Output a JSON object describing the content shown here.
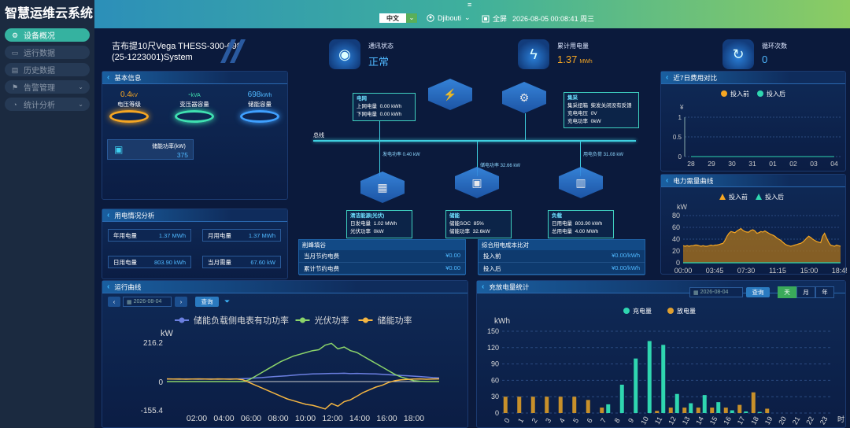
{
  "app": {
    "title": "智慧运维云系统"
  },
  "sidebar": {
    "items": [
      {
        "label": "设备概况",
        "icon": "gear-icon",
        "active": true
      },
      {
        "label": "运行数据",
        "icon": "monitor-icon"
      },
      {
        "label": "历史数据",
        "icon": "history-icon"
      },
      {
        "label": "告警管理",
        "icon": "bell-icon",
        "chevron": "⌄"
      },
      {
        "label": "统计分析",
        "icon": "stats-icon",
        "chevron": "⌄"
      }
    ]
  },
  "topbar": {
    "menu_glyph": "≡",
    "language": "中文",
    "language_chevron": "⌄",
    "user": "Djibouti",
    "user_chevron": "⌄",
    "fullscreen": "全屏",
    "datetime": "2026-08-05 00:08:41 周三"
  },
  "system": {
    "name_line1": "吉布提10尺Vega THESS-300-698",
    "name_line2": "(25-1223001)System"
  },
  "status": {
    "comm_label": "通讯状态",
    "comm_value": "正常",
    "energy_label": "累计用电量",
    "energy_value": "1.37",
    "energy_unit": "MWh",
    "cycles_label": "循环次数",
    "cycles_value": "0"
  },
  "basic": {
    "title": "基本信息",
    "voltage_value": "0.4",
    "voltage_unit": "kV",
    "voltage_label": "电压等级",
    "transformer_value": "-",
    "transformer_unit": "kVA",
    "transformer_label": "变压器容量",
    "storage_value": "698",
    "storage_unit": "kWh",
    "storage_label": "储能容量",
    "power_label": "储能功率(kW)",
    "power_value": "375"
  },
  "usage": {
    "title": "用电情况分析",
    "year_label": "年用电量",
    "year_value": "1.37 MWh",
    "month_label": "月用电量",
    "month_value": "1.37 MWh",
    "day_label": "日用电量",
    "day_value": "803.90 kWh",
    "demand_label": "当月需量",
    "demand_value": "67.60 kW"
  },
  "flow": {
    "bus_label": "总线",
    "grid": {
      "title": "电网",
      "r1_label": "上网电量",
      "r1_value": "0.00 kWh",
      "r2_label": "下网电量",
      "r2_value": "0.00 kWh"
    },
    "collector": {
      "title": "集采",
      "r1_label": "集采扭箱",
      "r1_value": "柴发关闭没有反馈",
      "r2_label": "充电电压",
      "r2_value": "0V",
      "r3_label": "充电功率",
      "r3_value": "0kW"
    },
    "pv_power": "发电功率 0.40 kW",
    "storage_power": "储电功率 32.66 kW",
    "load_power": "用电负荷 31.08 kW",
    "pv": {
      "title": "清洁能源(光伏)",
      "r1_label": "日发电量",
      "r1_value": "1.02 MWh",
      "r2_label": "光伏功率",
      "r2_value": "0kW"
    },
    "ess": {
      "title": "储能",
      "r1_label": "储能SOC",
      "r1_value": "85%",
      "r2_label": "储能功率",
      "r2_value": "32.6kW"
    },
    "load": {
      "title": "负载",
      "r1_label": "日用电量",
      "r1_value": "803.90 kWh",
      "r2_label": "总用电量",
      "r2_value": "4.00 MWh"
    }
  },
  "peak": {
    "title": "削峰填谷",
    "r1_label": "当月节约电费",
    "r1_value": "¥0.00",
    "r2_label": "累计节约电费",
    "r2_value": "¥0.00"
  },
  "cost": {
    "title": "综合用电成本比对",
    "r1_label": "投入前",
    "r1_value": "¥0.00/kWh",
    "r2_label": "投入后",
    "r2_value": "¥0.00/kWh"
  },
  "weekly": {
    "title": "近7日费用对比",
    "legend_before": "投入前",
    "legend_after": "投入后",
    "ylabel": "¥",
    "chart_data": {
      "type": "line",
      "categories": [
        "28",
        "29",
        "30",
        "31",
        "01",
        "02",
        "03",
        "04"
      ],
      "series": [
        {
          "name": "投入前",
          "values": [
            0,
            0,
            0,
            0,
            0,
            0,
            0,
            0
          ]
        },
        {
          "name": "投入后",
          "values": [
            0,
            0,
            0,
            0,
            0,
            0,
            0,
            0
          ]
        }
      ],
      "ylim": [
        0,
        1
      ],
      "yticks": [
        "1",
        "0.5",
        "0"
      ]
    }
  },
  "demand": {
    "title": "电力需量曲线",
    "legend_before": "投入前",
    "legend_after": "投入后",
    "ylabel": "kW",
    "chart_data": {
      "type": "area",
      "xticks": [
        "00:00",
        "03:45",
        "07:30",
        "11:15",
        "15:00",
        "18:45"
      ],
      "yticks": [
        "80",
        "60",
        "40",
        "20",
        "0"
      ],
      "ylim": [
        0,
        80
      ],
      "series": [
        {
          "name": "投入前",
          "values": [
            29,
            28,
            29,
            28,
            29,
            29,
            30,
            30,
            29,
            28,
            29,
            28,
            28,
            29,
            30,
            29,
            30,
            30,
            31,
            32,
            33,
            38,
            45,
            50,
            53,
            52,
            51,
            54,
            56,
            58,
            55,
            53,
            52,
            52,
            55,
            56,
            54,
            50,
            51,
            53,
            52,
            54,
            52,
            50,
            48,
            47,
            45,
            42,
            40,
            38,
            35,
            32,
            30,
            29,
            28,
            29,
            30,
            31,
            32,
            33,
            35,
            38,
            42,
            45,
            43,
            40,
            38,
            36,
            35,
            34,
            45,
            50,
            42,
            35,
            30,
            29,
            28,
            30,
            29,
            28
          ]
        },
        {
          "name": "投入后",
          "values": [
            0,
            0,
            0,
            0,
            0,
            0,
            0,
            0,
            0,
            0,
            0,
            0,
            0,
            0,
            0,
            0,
            0,
            0,
            0,
            0,
            0,
            0,
            0,
            0,
            0,
            0,
            0,
            0,
            0,
            0,
            0,
            0,
            0,
            0,
            0,
            0,
            0,
            0,
            0,
            0,
            0,
            0,
            0,
            0,
            0,
            0,
            0,
            0,
            0,
            0,
            0,
            0,
            0,
            0,
            0,
            0,
            0,
            0,
            0,
            0,
            0,
            0,
            0,
            0,
            0,
            0,
            0,
            0,
            0,
            0,
            0,
            0,
            0,
            0,
            0,
            0,
            0,
            0,
            0,
            0
          ]
        }
      ]
    }
  },
  "run": {
    "title": "运行曲线",
    "date": "2026-08-04",
    "query": "查询",
    "prev": "‹",
    "next": "›",
    "ylabel": "kW",
    "chart_data": {
      "type": "line",
      "xticks": [
        "02:00",
        "04:00",
        "06:00",
        "08:00",
        "10:00",
        "12:00",
        "14:00",
        "16:00",
        "18:00"
      ],
      "yticks": [
        "216.2",
        "0",
        "-155.4"
      ],
      "ylim": [
        -155.4,
        216.2
      ],
      "series": [
        {
          "name": "储能负载侧电表有功功率",
          "color": "#6b7fe0",
          "values": [
            15,
            14,
            13,
            15,
            14,
            13,
            14,
            15,
            13,
            14,
            15,
            14,
            16,
            18,
            20,
            22,
            25,
            28,
            30,
            32,
            35,
            38,
            40,
            42,
            43,
            44,
            45,
            45,
            46,
            44,
            45,
            44,
            43,
            42,
            40,
            38,
            36,
            34,
            32,
            30,
            28,
            25,
            22,
            20
          ]
        },
        {
          "name": "光伏功率",
          "color": "#8bd46a",
          "values": [
            0,
            0,
            0,
            0,
            0,
            0,
            0,
            0,
            0,
            0,
            0,
            0,
            0,
            10,
            30,
            50,
            70,
            90,
            110,
            125,
            140,
            150,
            160,
            170,
            175,
            200,
            210,
            180,
            190,
            170,
            160,
            140,
            120,
            100,
            80,
            60,
            40,
            25,
            15,
            5,
            2,
            0,
            0,
            0
          ]
        },
        {
          "name": "储能功率",
          "color": "#f5b642",
          "values": [
            15,
            14,
            15,
            13,
            14,
            15,
            14,
            13,
            15,
            14,
            13,
            15,
            10,
            -5,
            -20,
            -35,
            -50,
            -65,
            -80,
            -95,
            -105,
            -115,
            -125,
            -130,
            -140,
            -150,
            -120,
            -135,
            -110,
            -100,
            -80,
            -60,
            -45,
            -30,
            -20,
            -5,
            5,
            10,
            12,
            14,
            15,
            13,
            14,
            15
          ]
        }
      ]
    }
  },
  "charge": {
    "title": "充放电量统计",
    "date": "2026-08-04",
    "query": "查询",
    "tabs": [
      "天",
      "月",
      "年"
    ],
    "legend_charge": "充电量",
    "legend_discharge": "放电量",
    "ylabel": "kWh",
    "xunit": "时",
    "chart_data": {
      "type": "bar",
      "categories": [
        "0",
        "1",
        "2",
        "3",
        "4",
        "5",
        "6",
        "7",
        "8",
        "9",
        "10",
        "11",
        "12",
        "13",
        "14",
        "15",
        "16",
        "17",
        "18",
        "19",
        "20",
        "21",
        "22",
        "23"
      ],
      "ylim": [
        0,
        150
      ],
      "yticks": [
        "150",
        "120",
        "90",
        "60",
        "30",
        "0"
      ],
      "series": [
        {
          "name": "充电量",
          "values": [
            0,
            0,
            0,
            0,
            0,
            0,
            0,
            16,
            52,
            100,
            132,
            125,
            35,
            18,
            33,
            20,
            5,
            3,
            2,
            0,
            0,
            0,
            0,
            0
          ]
        },
        {
          "name": "放电量",
          "values": [
            30,
            30,
            30,
            30,
            30,
            30,
            24,
            10,
            0,
            0,
            0,
            4,
            10,
            10,
            10,
            10,
            10,
            15,
            38,
            8,
            0,
            0,
            0,
            0
          ]
        }
      ]
    }
  }
}
